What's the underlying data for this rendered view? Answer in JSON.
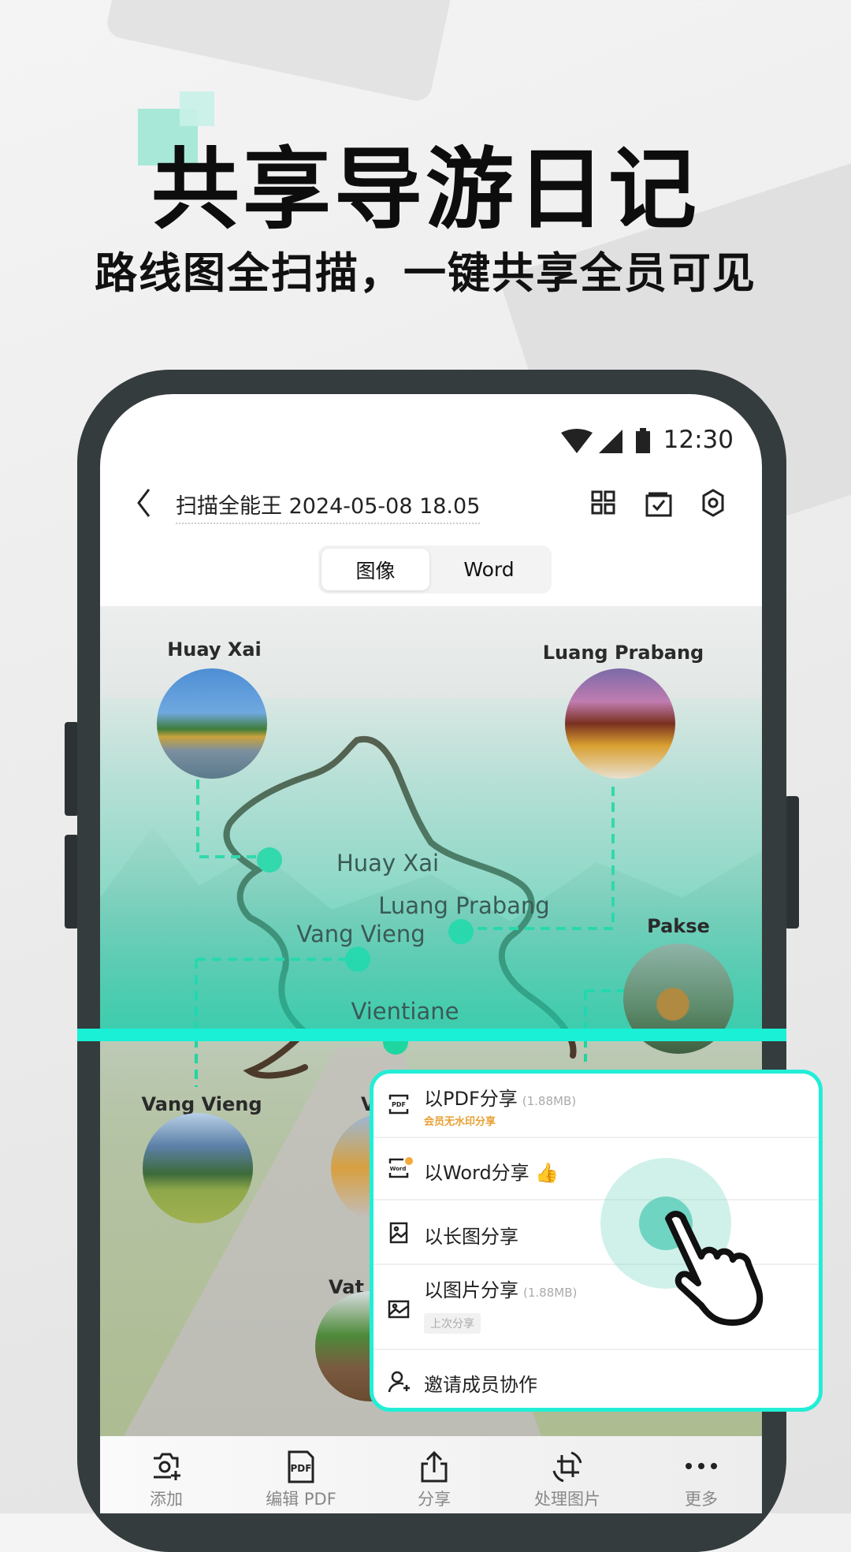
{
  "promo": {
    "title": "共享导游日记",
    "subtitle": "路线图全扫描，一键共享全员可见"
  },
  "status_bar": {
    "time": "12:30",
    "icons": [
      "wifi-icon",
      "signal-icon",
      "battery-icon"
    ]
  },
  "header": {
    "title": "扫描全能王 2024-05-08 18.05",
    "icons": [
      "back-icon",
      "grid-view-icon",
      "multi-select-icon",
      "settings-icon"
    ]
  },
  "view_toggle": {
    "options": [
      "图像",
      "Word"
    ],
    "selected": "图像"
  },
  "map": {
    "photo_labels": {
      "huay_xai": "Huay Xai",
      "luang_prabang": "Luang Prabang",
      "pakse": "Pakse",
      "vang_vieng": "Vang Vieng",
      "v_partial": "V",
      "vat_partial": "Vat P"
    },
    "route_labels": {
      "huay_xai": "Huay Xai",
      "luang_prabang": "Luang Prabang",
      "vang_vieng": "Vang Vieng",
      "vientiane": "Vientiane"
    }
  },
  "share_menu": {
    "items": [
      {
        "label": "以PDF分享",
        "size": "(1.88MB)",
        "note": "会员无水印分享",
        "icon": "pdf-icon"
      },
      {
        "label": "以Word分享",
        "icon": "word-icon",
        "badge": "thumbs-up-icon"
      },
      {
        "label": "以长图分享",
        "icon": "long-image-icon"
      },
      {
        "label": "以图片分享",
        "size": "(1.88MB)",
        "tag": "上次分享",
        "icon": "image-icon"
      },
      {
        "label": "邀请成员协作",
        "icon": "add-user-icon"
      }
    ]
  },
  "bottom_bar": {
    "items": [
      {
        "label": "添加",
        "icon": "camera-add-icon"
      },
      {
        "label": "编辑 PDF",
        "icon": "pdf-edit-icon"
      },
      {
        "label": "分享",
        "icon": "share-icon"
      },
      {
        "label": "处理图片",
        "icon": "crop-rotate-icon"
      },
      {
        "label": "更多",
        "icon": "more-icon"
      }
    ]
  },
  "colors": {
    "accent": "#1af0d6",
    "route_green": "#1fd6a0",
    "note_orange": "#e8a033"
  }
}
